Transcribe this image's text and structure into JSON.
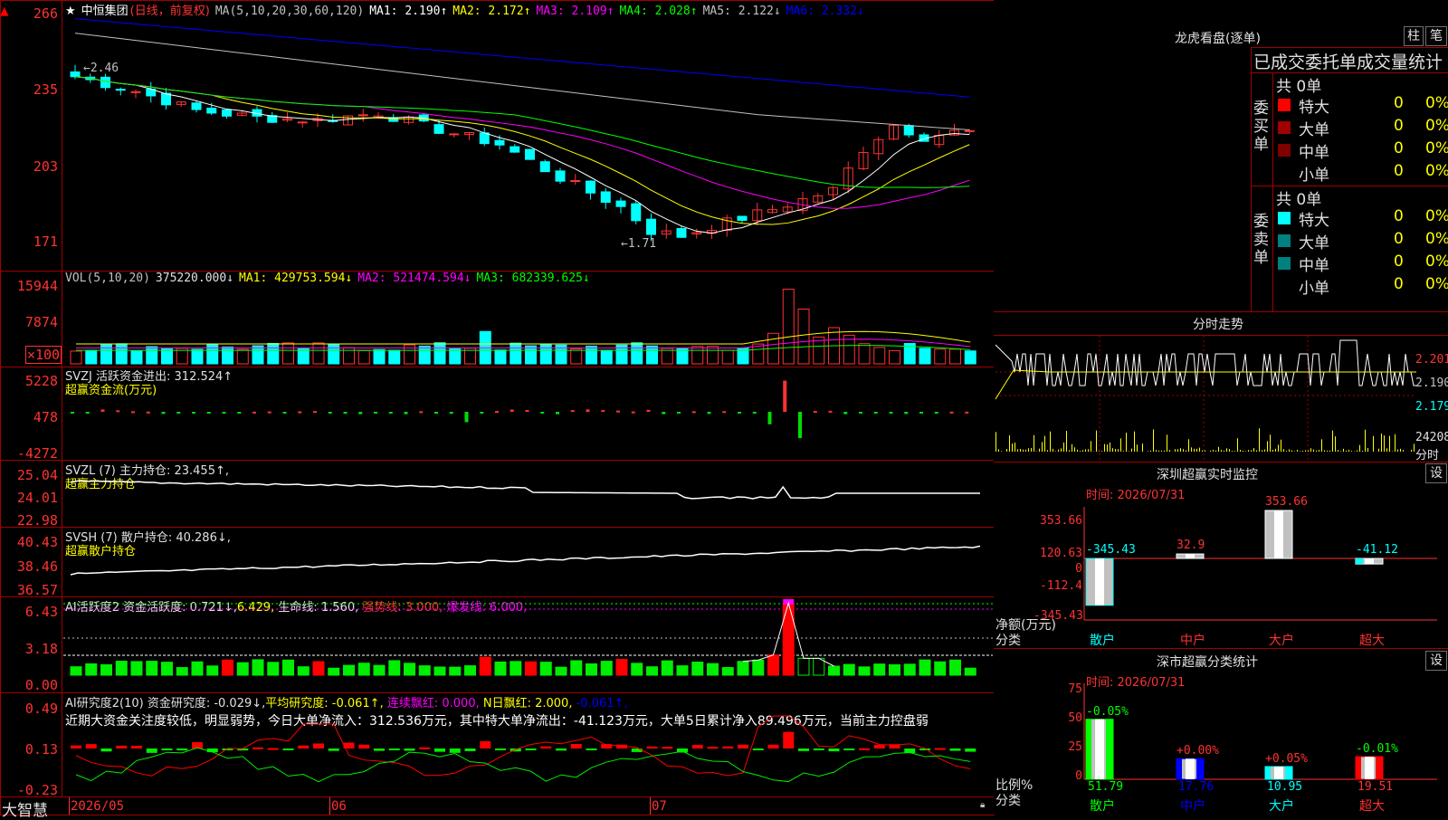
{
  "stock": {
    "star": "★",
    "name": "中恒集团",
    "period": "(日线，前复权)"
  },
  "ma_line": {
    "label": "MA(5,10,20,30,60,120)",
    "items": [
      {
        "t": "MA1: 2.190↑",
        "c": "#ffffff"
      },
      {
        "t": "MA2: 2.172↑",
        "c": "#ffff00"
      },
      {
        "t": "MA3: 2.109↑",
        "c": "#ff00ff"
      },
      {
        "t": "MA4: 2.028↑",
        "c": "#00ff00"
      },
      {
        "t": "MA5: 2.122↓",
        "c": "#c0c0c0"
      },
      {
        "t": "MA6: 2.332↓",
        "c": "#0000ff"
      }
    ]
  },
  "price_axis": [
    "266",
    "235",
    "203",
    "171"
  ],
  "price_marks": {
    "high": "←2.46",
    "low": "←1.71"
  },
  "vol_header": {
    "label": "VOL(5,10,20)",
    "value": "375220.000↓",
    "ma1": "MA1: 429753.594↓",
    "ma2": "MA2: 521474.594↓",
    "ma3": "MA3: 682339.625↓"
  },
  "vol_axis": [
    "15944",
    "7874",
    "×100"
  ],
  "svzj": {
    "line1": "SVZJ  活跃资金进出: 312.524↑",
    "line2": "超赢资金流(万元)",
    "axis": [
      "5228",
      "478",
      "-4272"
    ]
  },
  "svzl": {
    "line1": "SVZL (7) 主力持仓: 23.455↑,",
    "line2": "超赢主力持仓",
    "axis": [
      "25.04",
      "24.01",
      "22.98"
    ]
  },
  "svsh": {
    "line1": "SVSH (7) 散户持仓: 40.286↓,",
    "line2": "超赢散户持仓",
    "axis": [
      "40.43",
      "38.46",
      "36.57"
    ]
  },
  "ai2": {
    "p1": "AI活跃度2 资金活跃度: 0.721↓,",
    "p2": "6.429,",
    "p3": "生命线: 1.560,",
    "p4": "强势线: 3.000,",
    "p5": "爆发线: 6.000,",
    "axis": [
      "6.43",
      "3.18",
      "0.00"
    ]
  },
  "ai_research": {
    "p1": "AI研究度2(10) 资金研究度: -0.029↓,",
    "p2": "平均研究度: -0.061↑,",
    "p3": "连续飘红: 0.000,",
    "p4": "N日飘红: 2.000,",
    "p5": "-0.061↑,",
    "summary": "近期大资金关注度较低，明显弱势，今日大单净流入：312.536万元，其中特大单净流出：-41.123万元，大单5日累计净入89.496万元，当前主力控盘弱",
    "axis": [
      "0.49",
      "0.13",
      "-0.23"
    ]
  },
  "bottom": {
    "brand": "大智慧",
    "dates": [
      "2026/05",
      "06",
      "07"
    ]
  },
  "right": {
    "dragon_title": "龙虎看盘(逐单)",
    "btn1": "柱",
    "btn2": "笔",
    "order_header": "已成交委托单成交量统计",
    "buy_label": "委买单",
    "sell_label": "委卖单",
    "buy_total": "共 0单",
    "sell_total": "共 0单",
    "buy_rows": [
      {
        "n": "特大",
        "v": "0",
        "p": "0%",
        "c": "#ff0000"
      },
      {
        "n": "大单",
        "v": "0",
        "p": "0%",
        "c": "#a00000"
      },
      {
        "n": "中单",
        "v": "0",
        "p": "0%",
        "c": "#800000"
      },
      {
        "n": "小单",
        "v": "0",
        "p": "0%",
        "c": "#000000"
      }
    ],
    "sell_rows": [
      {
        "n": "特大",
        "v": "0",
        "p": "0%",
        "c": "#00ffff"
      },
      {
        "n": "大单",
        "v": "0",
        "p": "0%",
        "c": "#008080"
      },
      {
        "n": "中单",
        "v": "0",
        "p": "0%",
        "c": "#008080"
      },
      {
        "n": "小单",
        "v": "0",
        "p": "0%",
        "c": "#000000"
      }
    ],
    "intraday_title": "分时走势",
    "intraday_axis": [
      "2.201",
      "2.190",
      "2.179"
    ],
    "intraday_vol": "24208",
    "intraday_vol_unit": "分时",
    "sz_title": "深圳超赢实时监控",
    "sz_btn": "设",
    "sz_time": "时间: 2026/07/31",
    "sz_axis": [
      "353.66",
      "120.63",
      "0",
      "-112.4",
      "-345.43"
    ],
    "sz_unit1": "净额(万元)",
    "sz_unit2": "分类",
    "sz_bars": [
      {
        "cat": "散户",
        "val": "-345.43"
      },
      {
        "cat": "中户",
        "val": "32.9"
      },
      {
        "cat": "大户",
        "val": "353.66"
      },
      {
        "cat": "超大",
        "val": "-41.12"
      }
    ],
    "sh_title": "深市超赢分类统计",
    "sh_btn": "设",
    "sh_time": "时间: 2026/07/31",
    "sh_axis": [
      "75",
      "50",
      "25",
      "0"
    ],
    "sh_unit1": "比例%",
    "sh_unit2": "分类",
    "sh_bars": [
      {
        "cat": "散户",
        "top": "-0.05%",
        "bottom": "51.79"
      },
      {
        "cat": "中户",
        "top": "+0.00%",
        "bottom": "17.76"
      },
      {
        "cat": "大户",
        "top": "+0.05%",
        "bottom": "10.95"
      },
      {
        "cat": "超大",
        "top": "-0.01%",
        "bottom": "19.51"
      }
    ]
  }
}
